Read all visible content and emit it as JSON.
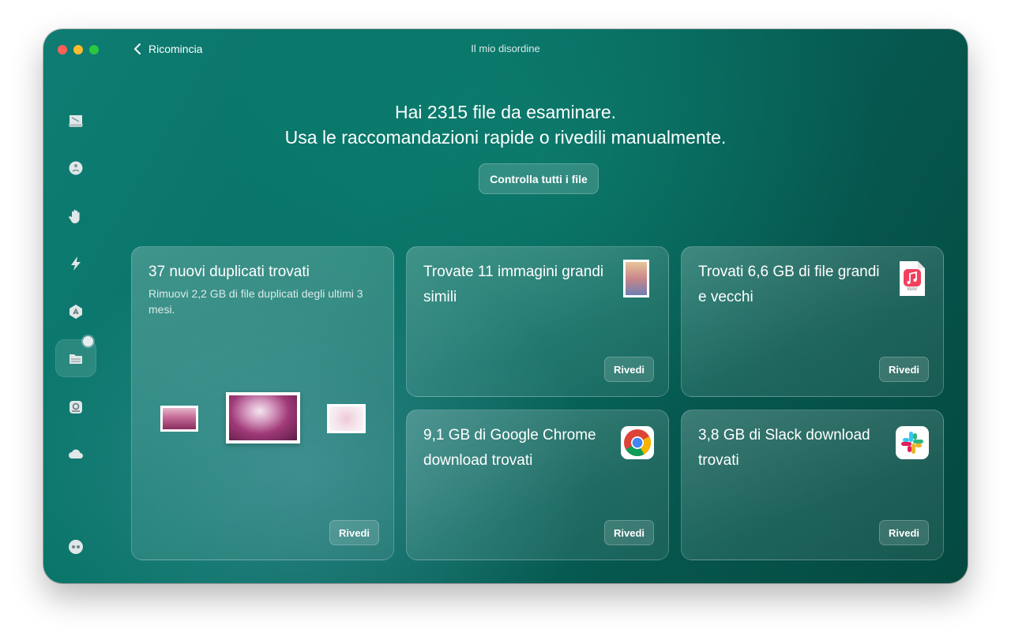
{
  "window": {
    "title": "Il mio disordine"
  },
  "toolbar": {
    "back_label": "Ricomincia"
  },
  "sidebar": {
    "items": [
      {
        "name": "sidebar-item-cleanup",
        "icon": "hdd-icon"
      },
      {
        "name": "sidebar-item-protection",
        "icon": "shield-icon"
      },
      {
        "name": "sidebar-item-privacy",
        "icon": "hand-icon"
      },
      {
        "name": "sidebar-item-speed",
        "icon": "bolt-icon"
      },
      {
        "name": "sidebar-item-applications",
        "icon": "app-store-icon"
      },
      {
        "name": "sidebar-item-my-clutter",
        "icon": "folder-drive-icon",
        "active": true
      },
      {
        "name": "sidebar-item-space-lens",
        "icon": "lens-icon"
      },
      {
        "name": "sidebar-item-cloud",
        "icon": "cloud-icon"
      }
    ],
    "bottom_icon": "assistant-icon"
  },
  "headline": {
    "line1": "Hai 2315 file da esaminare.",
    "line2": "Usa le raccomandazioni rapide o rivedili manualmente."
  },
  "check_all_label": "Controlla tutti i file",
  "cards": {
    "duplicates": {
      "title": "37 nuovi duplicati trovati",
      "description": "Rimuovi 2,2 GB di file duplicati degli ultimi 3 mesi.",
      "button": "Rivedi"
    },
    "similar_images": {
      "title": "Trovate 11 immagini grandi simili",
      "button": "Rivedi"
    },
    "large_old": {
      "title": "Trovati 6,6 GB di file grandi e vecchi",
      "file_badge": "WAV",
      "button": "Rivedi"
    },
    "chrome": {
      "title": "9,1 GB di Google Chrome download trovati",
      "button": "Rivedi"
    },
    "slack": {
      "title": "3,8 GB di Slack download trovati",
      "button": "Rivedi"
    }
  },
  "colors": {
    "bg_start": "#0f7d73",
    "bg_end": "#044940",
    "traffic_red": "#fe5f57",
    "traffic_yellow": "#febc2e",
    "traffic_green": "#28c840"
  }
}
